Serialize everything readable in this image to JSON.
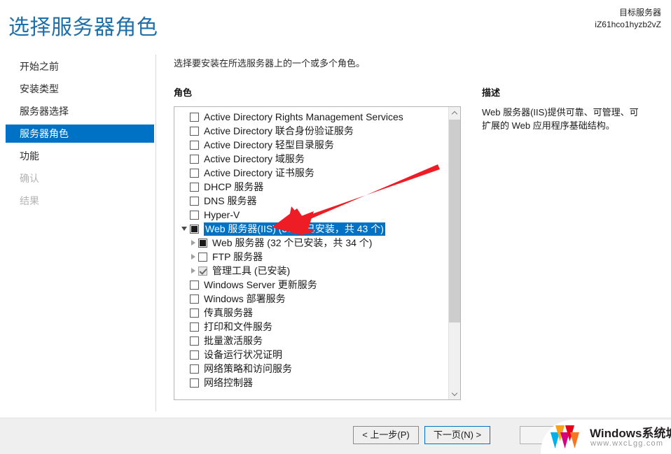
{
  "header": {
    "title": "选择服务器角色",
    "target_server_label": "目标服务器",
    "target_server_name": "iZ61hco1hyzb2vZ"
  },
  "sidebar": {
    "items": [
      {
        "label": "开始之前",
        "state": "normal"
      },
      {
        "label": "安装类型",
        "state": "normal"
      },
      {
        "label": "服务器选择",
        "state": "normal"
      },
      {
        "label": "服务器角色",
        "state": "selected"
      },
      {
        "label": "功能",
        "state": "normal"
      },
      {
        "label": "确认",
        "state": "disabled"
      },
      {
        "label": "结果",
        "state": "disabled"
      }
    ]
  },
  "main": {
    "instruction": "选择要安装在所选服务器上的一个或多个角色。",
    "roles_label": "角色",
    "roles": [
      {
        "label": "Active Directory Rights Management Services",
        "checkbox": "empty",
        "level": 0,
        "expander": "none",
        "selected": false
      },
      {
        "label": "Active Directory 联合身份验证服务",
        "checkbox": "empty",
        "level": 0,
        "expander": "none",
        "selected": false
      },
      {
        "label": "Active Directory 轻型目录服务",
        "checkbox": "empty",
        "level": 0,
        "expander": "none",
        "selected": false
      },
      {
        "label": "Active Directory 域服务",
        "checkbox": "empty",
        "level": 0,
        "expander": "none",
        "selected": false
      },
      {
        "label": "Active Directory 证书服务",
        "checkbox": "empty",
        "level": 0,
        "expander": "none",
        "selected": false
      },
      {
        "label": "DHCP 服务器",
        "checkbox": "empty",
        "level": 0,
        "expander": "none",
        "selected": false
      },
      {
        "label": "DNS 服务器",
        "checkbox": "empty",
        "level": 0,
        "expander": "none",
        "selected": false
      },
      {
        "label": "Hyper-V",
        "checkbox": "empty",
        "level": 0,
        "expander": "none",
        "selected": false
      },
      {
        "label": "Web 服务器(IIS) (39 个已安装，共 43 个)",
        "checkbox": "partial",
        "level": 0,
        "expander": "expanded",
        "selected": true
      },
      {
        "label": "Web 服务器 (32 个已安装，共 34 个)",
        "checkbox": "partial",
        "level": 1,
        "expander": "collapsed",
        "selected": false
      },
      {
        "label": "FTP 服务器",
        "checkbox": "empty",
        "level": 1,
        "expander": "collapsed",
        "selected": false
      },
      {
        "label": "管理工具 (已安装)",
        "checkbox": "checked-disabled",
        "level": 1,
        "expander": "collapsed",
        "selected": false
      },
      {
        "label": "Windows Server 更新服务",
        "checkbox": "empty",
        "level": 0,
        "expander": "none",
        "selected": false
      },
      {
        "label": "Windows 部署服务",
        "checkbox": "empty",
        "level": 0,
        "expander": "none",
        "selected": false
      },
      {
        "label": "传真服务器",
        "checkbox": "empty",
        "level": 0,
        "expander": "none",
        "selected": false
      },
      {
        "label": "打印和文件服务",
        "checkbox": "empty",
        "level": 0,
        "expander": "none",
        "selected": false
      },
      {
        "label": "批量激活服务",
        "checkbox": "empty",
        "level": 0,
        "expander": "none",
        "selected": false
      },
      {
        "label": "设备运行状况证明",
        "checkbox": "empty",
        "level": 0,
        "expander": "none",
        "selected": false
      },
      {
        "label": "网络策略和访问服务",
        "checkbox": "empty",
        "level": 0,
        "expander": "none",
        "selected": false
      },
      {
        "label": "网络控制器",
        "checkbox": "empty",
        "level": 0,
        "expander": "none",
        "selected": false
      }
    ]
  },
  "description": {
    "title": "描述",
    "text": "Web 服务器(IIS)提供可靠、可管理、可扩展的 Web 应用程序基础结构。"
  },
  "footer": {
    "previous_label": "< 上一步(P)",
    "next_label": "下一页(N) >",
    "install_label": ""
  },
  "watermark": {
    "brand": "Windows系统城",
    "url": "www.wxcLgg.com"
  },
  "colors": {
    "accent": "#0072c6",
    "title": "#1f6fa8",
    "annotation_arrow": "#ee1c25"
  }
}
